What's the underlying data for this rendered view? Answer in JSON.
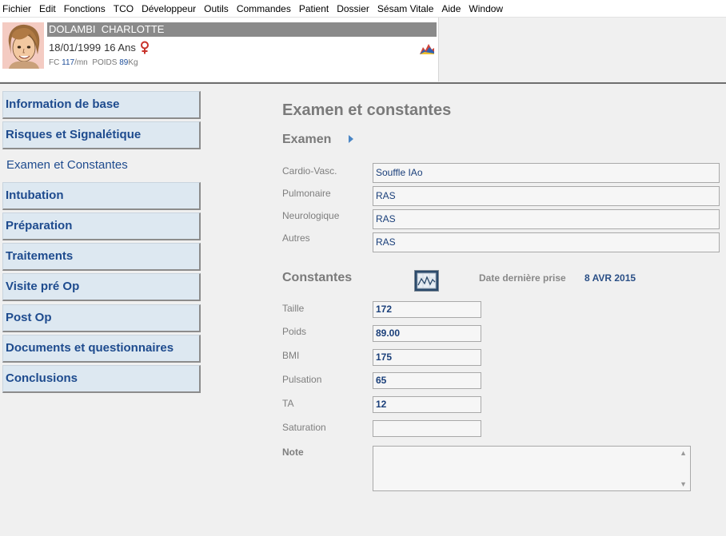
{
  "menu": [
    "Fichier",
    "Edit",
    "Fonctions",
    "TCO",
    "Développeur",
    "Outils",
    "Commandes",
    "Patient",
    "Dossier",
    "Sésam Vitale",
    "Aide",
    "Window"
  ],
  "patient": {
    "name": "DOLAMBI  CHARLOTTE",
    "dob": "18/01/1999",
    "age": "16 Ans",
    "fc_label": "FC",
    "fc_value": "117",
    "fc_unit": "/mn",
    "poids_label": "POIDS",
    "poids_value": "89",
    "poids_unit": "Kg"
  },
  "sidebar": {
    "items": [
      {
        "label": "Information de base"
      },
      {
        "label": "Risques et Signalétique"
      },
      {
        "label": "Examen et Constantes"
      },
      {
        "label": "Intubation"
      },
      {
        "label": "Préparation"
      },
      {
        "label": "Traitements"
      },
      {
        "label": "Visite pré Op"
      },
      {
        "label": "Post Op"
      },
      {
        "label": "Documents et questionnaires"
      },
      {
        "label": "Conclusions"
      }
    ]
  },
  "main": {
    "title": "Examen et constantes",
    "examen": {
      "title": "Examen",
      "fields": [
        {
          "label": "Cardio-Vasc.",
          "value": "Souffle IAo"
        },
        {
          "label": "Pulmonaire",
          "value": "RAS"
        },
        {
          "label": "Neurologique",
          "value": "RAS"
        },
        {
          "label": "Autres",
          "value": "RAS"
        }
      ]
    },
    "constantes": {
      "title": "Constantes",
      "date_label": "Date dernière prise",
      "date_value": "8 AVR 2015",
      "fields": [
        {
          "label": "Taille",
          "value": "172"
        },
        {
          "label": "Poids",
          "value": "89.00"
        },
        {
          "label": "BMI",
          "value": "175"
        },
        {
          "label": "Pulsation",
          "value": "65"
        },
        {
          "label": "TA",
          "value": "12"
        },
        {
          "label": "Saturation",
          "value": ""
        }
      ],
      "note_label": "Note",
      "note_value": ""
    }
  },
  "colors": {
    "nav_text": "#1e4b8e",
    "nav_bg": "#dde8f1",
    "title_grey": "#7a7a7a",
    "name_bar": "#8a8a8a"
  },
  "icons": {
    "avatar": "patient-avatar-illustration",
    "sex": "female-icon",
    "chart": "mountain-chart-icon",
    "expand": "expand-arrow-icon",
    "graph": "graph-icon"
  }
}
